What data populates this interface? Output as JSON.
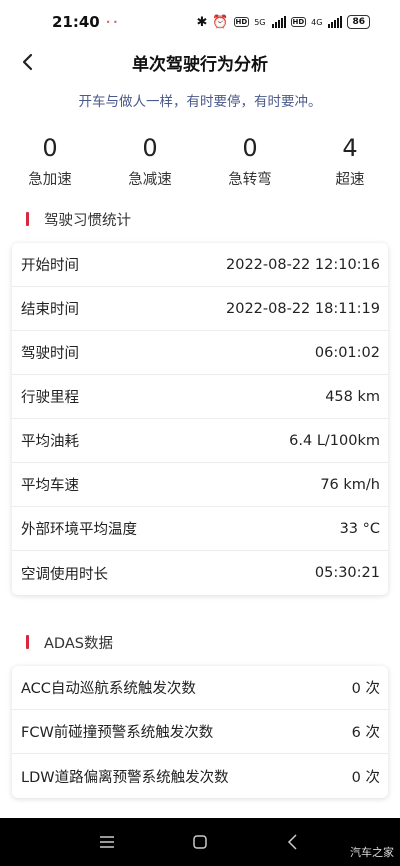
{
  "status_bar": {
    "time": "21:40",
    "indicator": "• •",
    "battery": "86",
    "net1": "5G",
    "net2": "4G",
    "hd": "HD"
  },
  "header": {
    "title": "单次驾驶行为分析",
    "subtitle": "开车与做人一样，有时要停，有时要冲。"
  },
  "counters": [
    {
      "value": "0",
      "label": "急加速"
    },
    {
      "value": "0",
      "label": "急减速"
    },
    {
      "value": "0",
      "label": "急转弯"
    },
    {
      "value": "4",
      "label": "超速"
    }
  ],
  "habits": {
    "title": "驾驶习惯统计",
    "rows": [
      {
        "label": "开始时间",
        "value": "2022-08-22 12:10:16"
      },
      {
        "label": "结束时间",
        "value": "2022-08-22 18:11:19"
      },
      {
        "label": "驾驶时间",
        "value": "06:01:02"
      },
      {
        "label": "行驶里程",
        "value": "458 km"
      },
      {
        "label": "平均油耗",
        "value": "6.4 L/100km"
      },
      {
        "label": "平均车速",
        "value": "76 km/h"
      },
      {
        "label": "外部环境平均温度",
        "value": "33 °C"
      },
      {
        "label": "空调使用时长",
        "value": "05:30:21"
      }
    ]
  },
  "adas": {
    "title": "ADAS数据",
    "rows": [
      {
        "label": "ACC自动巡航系统触发次数",
        "value": "0 次"
      },
      {
        "label": "FCW前碰撞预警系统触发次数",
        "value": "6 次"
      },
      {
        "label": "LDW道路偏离预警系统触发次数",
        "value": "0 次"
      }
    ]
  },
  "watermark": "汽车之家",
  "colors": {
    "accent": "#d9273f",
    "subtitle": "#4a5a8a",
    "nav": "#000000"
  },
  "icons": [
    "back-icon",
    "menu-icon",
    "home-icon",
    "nav-back-icon",
    "bluetooth-icon",
    "alarm-icon",
    "signal-icon",
    "battery-icon"
  ]
}
